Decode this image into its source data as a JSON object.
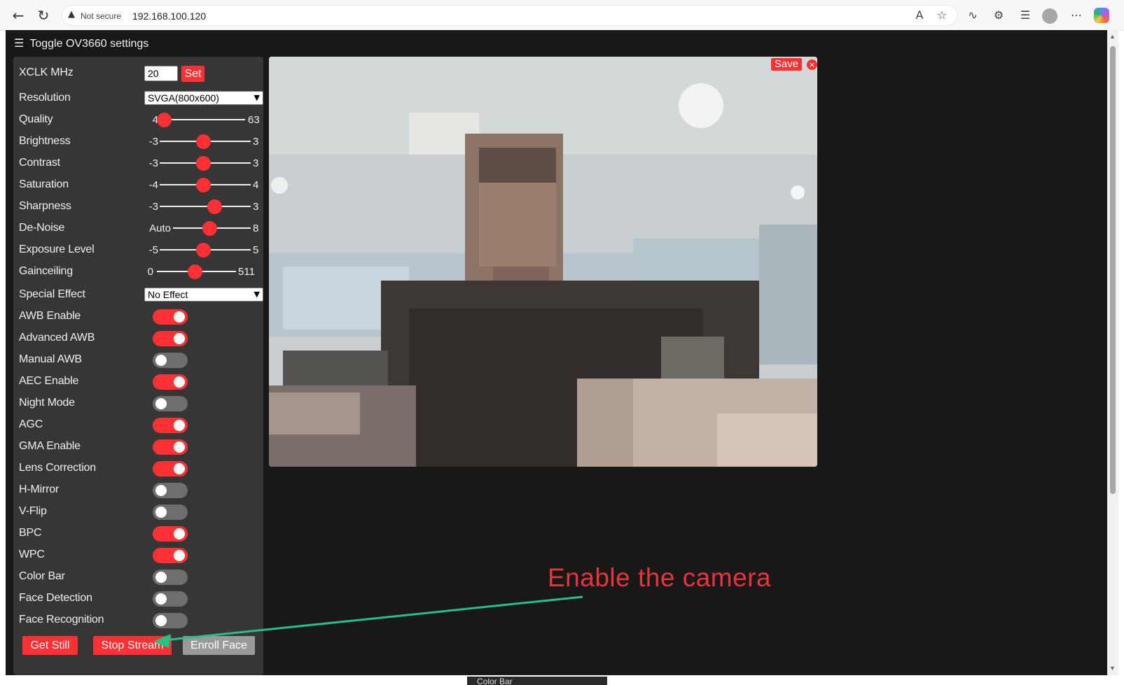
{
  "browser": {
    "security_text": "Not secure",
    "url": "192.168.100.120"
  },
  "page": {
    "menu_toggle_label": "Toggle OV3660 settings"
  },
  "settings": {
    "xclk": {
      "label": "XCLK MHz",
      "value": "20",
      "set_label": "Set"
    },
    "resolution": {
      "label": "Resolution",
      "selected": "SVGA(800x600)"
    },
    "sliders": [
      {
        "label": "Quality",
        "min": "4",
        "max": "63",
        "value": 4
      },
      {
        "label": "Brightness",
        "min": "-3",
        "max": "3",
        "value": 0
      },
      {
        "label": "Contrast",
        "min": "-3",
        "max": "3",
        "value": 0
      },
      {
        "label": "Saturation",
        "min": "-4",
        "max": "4",
        "value": 0
      },
      {
        "label": "Sharpness",
        "min": "-3",
        "max": "3",
        "value": 1
      },
      {
        "label": "De-Noise",
        "min": "Auto",
        "max": "8",
        "value": 4
      },
      {
        "label": "Exposure Level",
        "min": "-5",
        "max": "5",
        "value": 0
      },
      {
        "label": "Gainceiling",
        "min": "0",
        "max": "511",
        "value": 255
      }
    ],
    "special_effect": {
      "label": "Special Effect",
      "selected": "No Effect"
    },
    "toggles": [
      {
        "label": "AWB Enable",
        "on": true
      },
      {
        "label": "Advanced AWB",
        "on": true
      },
      {
        "label": "Manual AWB",
        "on": false
      },
      {
        "label": "AEC Enable",
        "on": true
      },
      {
        "label": "Night Mode",
        "on": false
      },
      {
        "label": "AGC",
        "on": true
      },
      {
        "label": "GMA Enable",
        "on": true
      },
      {
        "label": "Lens Correction",
        "on": true
      },
      {
        "label": "H-Mirror",
        "on": false
      },
      {
        "label": "V-Flip",
        "on": false
      },
      {
        "label": "BPC",
        "on": true
      },
      {
        "label": "WPC",
        "on": true
      },
      {
        "label": "Color Bar",
        "on": false
      },
      {
        "label": "Face Detection",
        "on": false
      },
      {
        "label": "Face Recognition",
        "on": false
      }
    ],
    "buttons": {
      "get_still": "Get Still",
      "stop_stream": "Stop Stream",
      "enroll_face": "Enroll Face"
    }
  },
  "stream": {
    "save_label": "Save",
    "close_label": "×"
  },
  "annotation": {
    "text": "Enable the camera"
  },
  "below_fold": {
    "peek_label": "Color Bar"
  }
}
